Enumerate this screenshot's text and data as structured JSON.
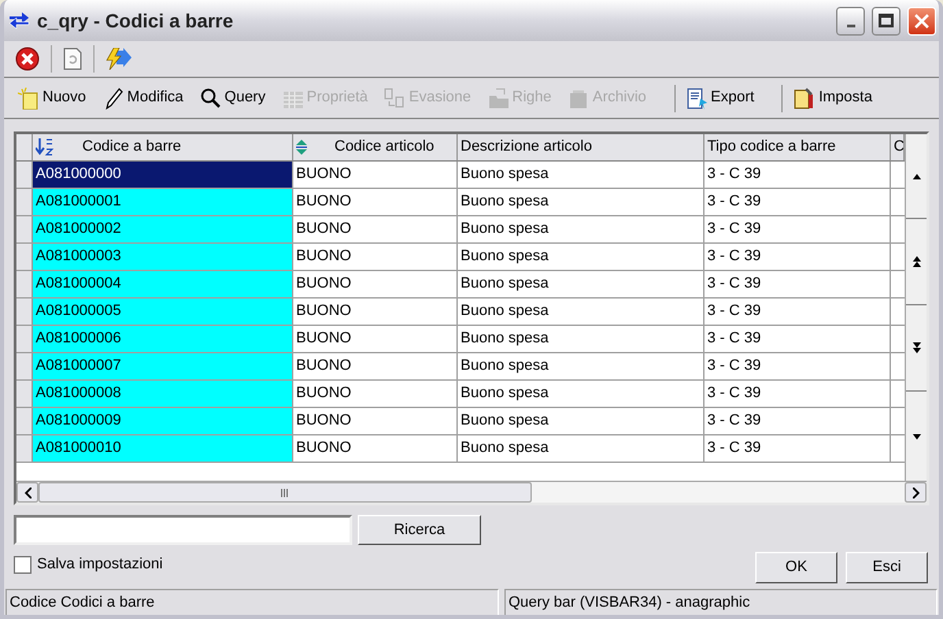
{
  "window": {
    "title": "c_qry - Codici a barre"
  },
  "toolbar_top": [
    {
      "kind": "close"
    },
    {
      "kind": "refresh"
    },
    {
      "kind": "flash"
    }
  ],
  "toolbar": [
    {
      "label": "Nuovo",
      "kind": "new",
      "disabled": false
    },
    {
      "label": "Modifica",
      "kind": "edit",
      "disabled": false
    },
    {
      "label": "Query",
      "kind": "search",
      "disabled": false
    },
    {
      "label": "Proprietà",
      "kind": "grid",
      "disabled": true
    },
    {
      "label": "Evasione",
      "kind": "pages",
      "disabled": true
    },
    {
      "label": "Righe",
      "kind": "folder",
      "disabled": true
    },
    {
      "label": "Archivio",
      "kind": "box",
      "disabled": true
    },
    {
      "label": "Export",
      "kind": "export",
      "disabled": false
    },
    {
      "label": "Imposta",
      "kind": "settings",
      "disabled": false
    }
  ],
  "table": {
    "columns": [
      {
        "label": "Codice a barre",
        "kind": "sorted"
      },
      {
        "label": "Codice articolo",
        "kind": "sortable"
      },
      {
        "label": "Descrizione articolo",
        "kind": "plain"
      },
      {
        "label": "Tipo codice a barre",
        "kind": "plain"
      },
      {
        "label": "C",
        "kind": "plain"
      }
    ],
    "rows": [
      {
        "selected": true,
        "cells": [
          "A081000000",
          "BUONO",
          "Buono spesa",
          "3 - C 39"
        ]
      },
      {
        "selected": false,
        "cells": [
          "A081000001",
          "BUONO",
          "Buono spesa",
          "3 - C 39"
        ]
      },
      {
        "selected": false,
        "cells": [
          "A081000002",
          "BUONO",
          "Buono spesa",
          "3 - C 39"
        ]
      },
      {
        "selected": false,
        "cells": [
          "A081000003",
          "BUONO",
          "Buono spesa",
          "3 - C 39"
        ]
      },
      {
        "selected": false,
        "cells": [
          "A081000004",
          "BUONO",
          "Buono spesa",
          "3 - C 39"
        ]
      },
      {
        "selected": false,
        "cells": [
          "A081000005",
          "BUONO",
          "Buono spesa",
          "3 - C 39"
        ]
      },
      {
        "selected": false,
        "cells": [
          "A081000006",
          "BUONO",
          "Buono spesa",
          "3 - C 39"
        ]
      },
      {
        "selected": false,
        "cells": [
          "A081000007",
          "BUONO",
          "Buono spesa",
          "3 - C 39"
        ]
      },
      {
        "selected": false,
        "cells": [
          "A081000008",
          "BUONO",
          "Buono spesa",
          "3 - C 39"
        ]
      },
      {
        "selected": false,
        "cells": [
          "A081000009",
          "BUONO",
          "Buono spesa",
          "3 - C 39"
        ]
      },
      {
        "selected": false,
        "cells": [
          "A081000010",
          "BUONO",
          "Buono spesa",
          "3 - C 39"
        ]
      }
    ]
  },
  "search": {
    "button": "Ricerca"
  },
  "save_settings": {
    "label": "Salva impostazioni",
    "checked": false
  },
  "buttons": [
    "OK",
    "Esci"
  ],
  "status_bar": [
    "Codice Codici a barre",
    "Query bar (VISBAR34) - anagraphic"
  ]
}
